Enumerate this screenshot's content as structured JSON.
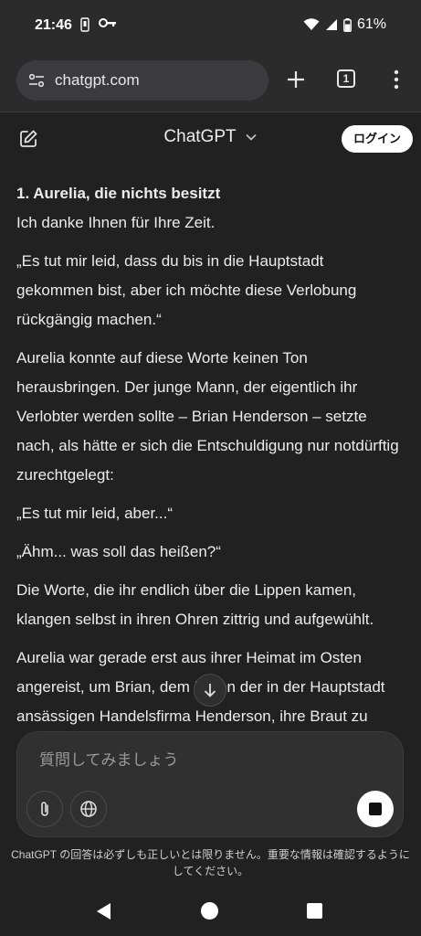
{
  "status": {
    "time": "21:46",
    "battery": "61%",
    "icons": [
      "notification-icon",
      "key-icon",
      "wifi-icon",
      "signal-icon",
      "battery-icon"
    ]
  },
  "browser": {
    "url": "chatgpt.com",
    "tab_count": "1",
    "icons": [
      "site-settings-icon",
      "plus-icon",
      "tabs-icon",
      "menu-icon"
    ]
  },
  "app": {
    "title": "ChatGPT",
    "login_label": "ログイン"
  },
  "message": {
    "heading": "1. Aurelia, die nichts besitzt",
    "paragraphs": [
      "Ich danke Ihnen für Ihre Zeit.",
      "„Es tut mir leid, dass du bis in die Hauptstadt gekommen bist, aber ich möchte diese Verlobung rückgängig machen.“",
      "Aurelia konnte auf diese Worte keinen Ton herausbringen. Der junge Mann, der eigentlich ihr Verlobter werden sollte – Brian Henderson – setzte nach, als hätte er sich die Entschuldigung nur notdürftig zurechtgelegt:",
      "„Es tut mir leid, aber...“",
      "„Ähm... was soll das heißen?“",
      "Die Worte, die ihr endlich über die Lippen kamen, klangen selbst in ihren Ohren zittrig und aufgewühlt.",
      "Aurelia war gerade erst aus ihrer Heimat im Osten angereist, um Brian, dem Erben der in der Hauptstadt ansässigen Handelsfirma Henderson, ihre Braut zu werden."
    ]
  },
  "composer": {
    "placeholder": "質問してみましょう"
  },
  "disclaimer": "ChatGPT の回答は必ずしも正しいとは限りません。重要な情報は確認するようにしてください。",
  "colors": {
    "background": "#212121",
    "browser_chrome": "#2b2b2b",
    "composer": "#303030",
    "text": "#ececec"
  }
}
